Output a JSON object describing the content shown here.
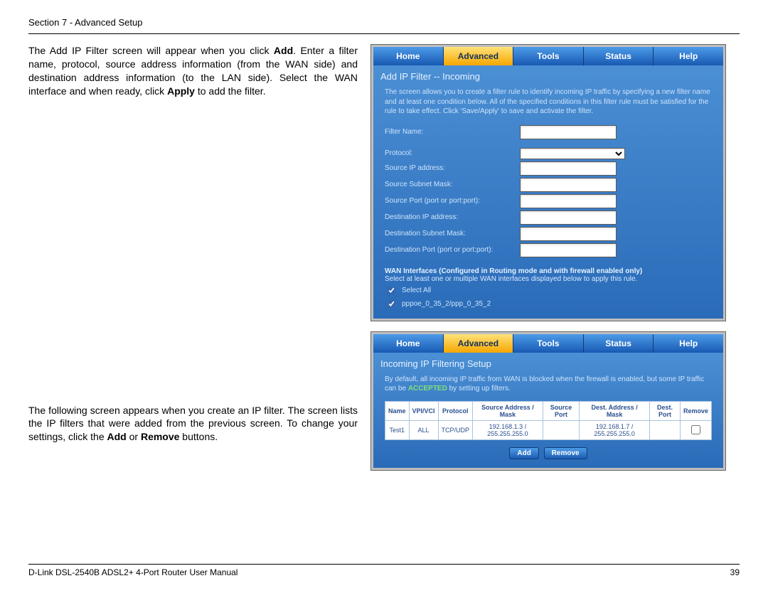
{
  "header": {
    "section": "Section 7 - Advanced Setup"
  },
  "body": {
    "para1": {
      "t1": "The Add IP Filter screen will appear when you click ",
      "add": "Add",
      "t2": ". Enter a filter name, protocol, source address information (from the WAN side) and destination address information (to the LAN side). Select the WAN interface and when ready, click ",
      "apply": "Apply",
      "t3": " to add the filter."
    },
    "para2": {
      "t1": "The following screen appears when you create an IP filter. The screen lists the IP filters that were added from the previous screen. To change your settings, click the ",
      "add": "Add",
      "t2": " or ",
      "remove": "Remove",
      "t3": " buttons."
    }
  },
  "ui": {
    "tabs": [
      "Home",
      "Advanced",
      "Tools",
      "Status",
      "Help"
    ]
  },
  "screen1": {
    "title": "Add IP Filter -- Incoming",
    "desc": "The screen allows you to create a filter rule to identify incoming IP traffic by specifying a new filter name and at least one condition below. All of the specified conditions in this filter rule must be satisfied for the rule to take effect. Click 'Save/Apply' to save and activate the filter.",
    "fields": {
      "filter_name": "Filter Name:",
      "protocol": "Protocol:",
      "src_ip": "Source IP address:",
      "src_mask": "Source Subnet Mask:",
      "src_port": "Source Port (port or port:port):",
      "dst_ip": "Destination IP address:",
      "dst_mask": "Destination Subnet Mask:",
      "dst_port": "Destination Port (port or port:port):"
    },
    "wan": {
      "heading": "WAN Interfaces (Configured in Routing mode and with firewall enabled only)",
      "sub": "Select at least one or multiple WAN interfaces displayed below to apply this rule.",
      "select_all": "Select All",
      "iface1": "pppoe_0_35_2/ppp_0_35_2"
    }
  },
  "screen2": {
    "title": "Incoming IP Filtering Setup",
    "desc_a": "By default, all incoming IP traffic from WAN is blocked when the firewall is enabled, but some IP traffic can be ",
    "accepted": "ACCEPTED",
    "desc_b": " by setting up filters.",
    "cols": [
      "Name",
      "VPI/VCI",
      "Protocol",
      "Source Address / Mask",
      "Source Port",
      "Dest. Address / Mask",
      "Dest. Port",
      "Remove"
    ],
    "row": {
      "name": "Test1",
      "vpivci": "ALL",
      "protocol": "TCP/UDP",
      "src": "192.168.1.3 / 255.255.255.0",
      "srcport": "",
      "dst": "192.168.1.7 / 255.255.255.0",
      "dstport": ""
    },
    "buttons": {
      "add": "Add",
      "remove": "Remove"
    }
  },
  "footer": {
    "title": "D-Link DSL-2540B ADSL2+ 4-Port Router User Manual",
    "page": "39"
  }
}
